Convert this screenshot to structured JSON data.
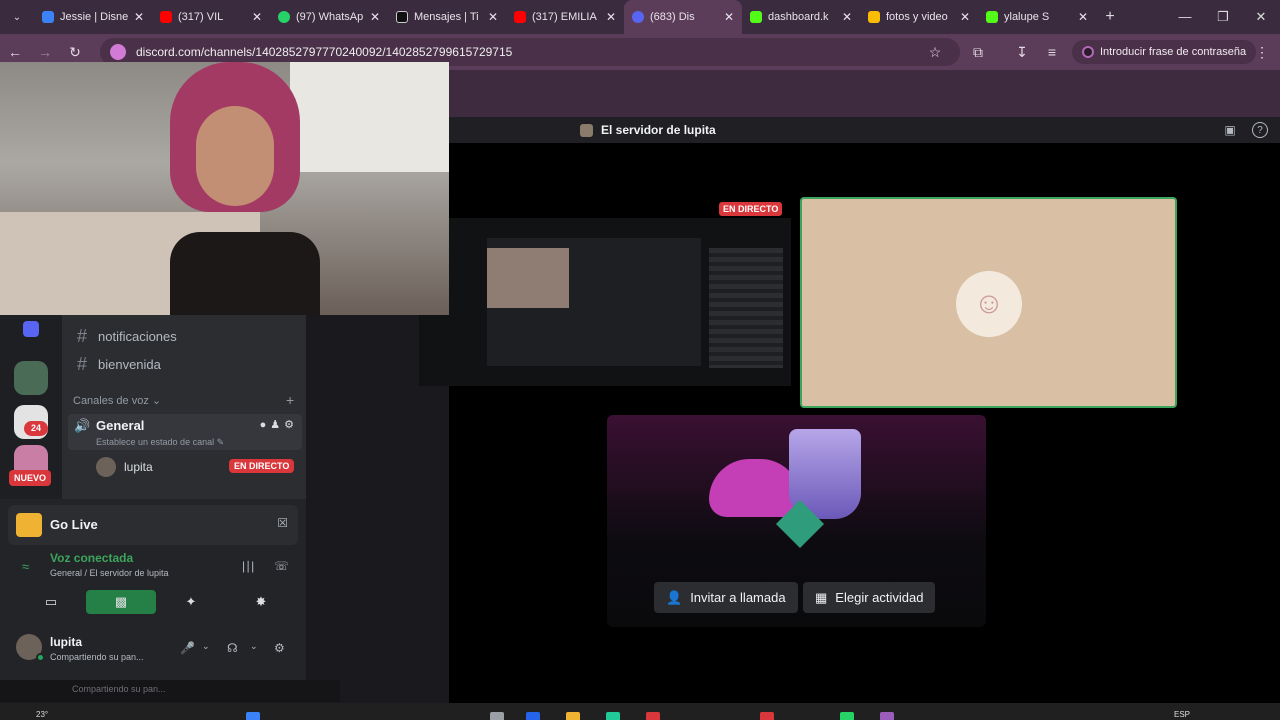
{
  "browser": {
    "tabs": [
      {
        "title": "Jessie | Disne",
        "color": "#3b82f6",
        "icon": "globe-icon"
      },
      {
        "title": "(317) VIL",
        "color": "#ff0000",
        "icon": "youtube-icon"
      },
      {
        "title": "(97) WhatsAp",
        "color": "#25d366",
        "icon": "whatsapp-icon"
      },
      {
        "title": "Mensajes | Ti",
        "color": "#000000",
        "icon": "tiktok-icon"
      },
      {
        "title": "(317) EMILIA",
        "color": "#ff0000",
        "icon": "youtube-icon"
      },
      {
        "title": "(683) Dis",
        "color": "#5865f2",
        "icon": "discord-icon"
      },
      {
        "title": "dashboard.k",
        "color": "#53fc18",
        "icon": "kick-icon"
      },
      {
        "title": "fotos y video",
        "color": "#fbbc04",
        "icon": "drive-icon"
      },
      {
        "title": "ylalupe S",
        "color": "#53fc18",
        "icon": "kick-icon"
      }
    ],
    "url": "discord.com/channels/1402852797770240092/1402852799615729715",
    "profile_label": "Introducir frase de contraseña",
    "accent": "#5b3d5a"
  },
  "discord": {
    "server_name": "El servidor de lupita",
    "live_badge": "EN DIRECTO",
    "buttons": {
      "invite": "Invitar a llamada",
      "activity": "Elegir actividad"
    },
    "channels": {
      "text": [
        "notificaciones",
        "bienvenida"
      ],
      "voice_category": "Canales de voz",
      "voice_channel": "General",
      "voice_status": "Establece un estado de canal",
      "voice_user": "lupita",
      "voice_user_badge": "EN DIRECTO"
    },
    "guilds": {
      "badge_count": "24",
      "new_label": "NUEVO"
    },
    "go_live": "Go Live",
    "voice_connection": {
      "status": "Voz conectada",
      "location": "General / El servidor de lupita"
    },
    "user": {
      "name": "lupita",
      "status": "Compartiendo su pan..."
    },
    "ghost_status": "Compartiendo su pan..."
  },
  "taskbar": {
    "temperature": "23°",
    "language": "ESP"
  }
}
